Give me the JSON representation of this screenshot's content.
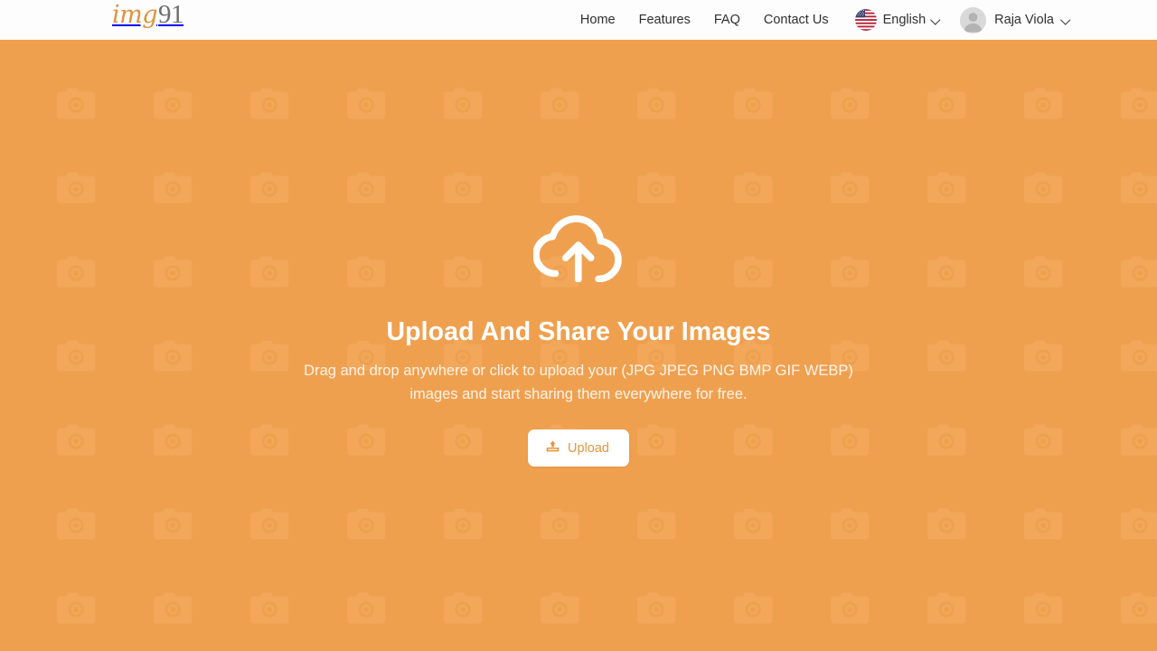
{
  "header": {
    "logo": {
      "part1": "img",
      "part2": "91",
      "part1_color": "#e0913f",
      "part2_color": "#6e6e6e"
    },
    "nav": [
      {
        "label": "Home",
        "name": "nav-link-home"
      },
      {
        "label": "Features",
        "name": "nav-link-features"
      },
      {
        "label": "FAQ",
        "name": "nav-link-faq"
      },
      {
        "label": "Contact Us",
        "name": "nav-link-contact-us"
      }
    ],
    "language": {
      "label": "English",
      "flag": "us-flag-icon",
      "chevron": "chevron-down-icon"
    },
    "user": {
      "name": "Raja Viola",
      "avatar": "default-avatar-icon",
      "chevron": "chevron-down-icon"
    },
    "background": "#fdfdfd"
  },
  "hero": {
    "icon": "cloud-upload-icon",
    "title": "Upload And Share Your Images",
    "subtitle_line1": "Drag and drop anywhere or click to upload your (JPG JPEG PNG BMP GIF WEBP)",
    "subtitle_line2": "images and start sharing them everywhere for free.",
    "upload_button": {
      "label": "Upload",
      "icon": "upload-arrow-icon"
    },
    "background_color": "#efa04f",
    "pattern_icon": "camera-icon",
    "pattern_color": "#f2a95c",
    "text_color": "#ffffff",
    "accent_color": "#e3973f"
  }
}
